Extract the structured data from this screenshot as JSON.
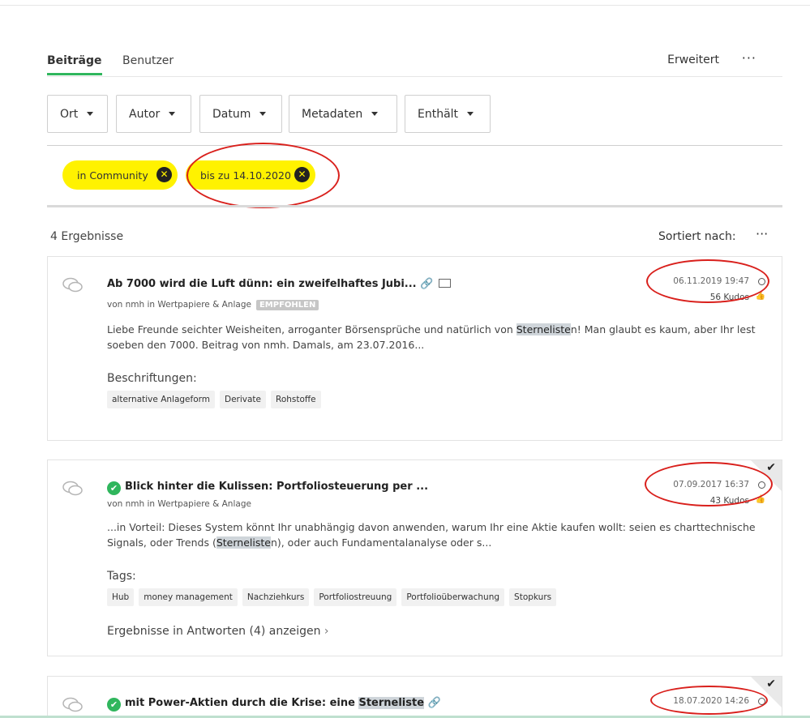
{
  "tabs": {
    "posts": "Beiträge",
    "users": "Benutzer",
    "advanced": "Erweitert",
    "more": "···"
  },
  "filters": [
    "Ort",
    "Autor",
    "Datum",
    "Metadaten",
    "Enthält"
  ],
  "chips": [
    "in Community",
    "bis zu 14.10.2020"
  ],
  "results": {
    "count": "4 Ergebnisse",
    "sort_label": "Sortiert nach:",
    "more": "···",
    "items": [
      {
        "title": "Ab 7000 wird die Luft dünn: ein zweifelhaftes Jubi...",
        "meta_by": "von nmh in Wertpapiere & Anlage",
        "badge": "EMPFOHLEN",
        "date": "06.11.2019 19:47",
        "kudos": "56 Kudos",
        "body_a": "Liebe Freunde seichter Weisheiten, arroganter Börsensprüche und natürlich von ",
        "body_hl": "Sterneliste",
        "body_b": "n!   Man glaubt es kaum, aber Ihr lest soeben den 7000. Beitrag von nmh.   Damals, am 23.07.2016...",
        "labels_heading": "Beschriftungen:",
        "labels": [
          "alternative Anlageform",
          "Derivate",
          "Rohstoffe"
        ]
      },
      {
        "title": "Blick hinter die Kulissen: Portfoliosteuerung per ...",
        "meta_by": "von nmh in Wertpapiere & Anlage",
        "date": "07.09.2017 16:37",
        "kudos": "43 Kudos",
        "body_a": "...in Vorteil: Dieses System könnt Ihr unabhängig davon anwenden, warum Ihr eine Aktie kaufen wollt: seien es charttechnische Signals, oder Trends (",
        "body_hl": "Sterneliste",
        "body_b": "n), oder auch Fundamentalanalyse oder s...",
        "labels_heading": "Tags:",
        "labels": [
          "Hub",
          "money management",
          "Nachziehkurs",
          "Portfoliostreuung",
          "Portfolioüberwachung",
          "Stopkurs"
        ],
        "replies": "Ergebnisse in Antworten (4) anzeigen"
      },
      {
        "title_a": "mit Power-Aktien durch die Krise: eine ",
        "title_hl": "Sterneliste",
        "date": "18.07.2020 14:26"
      }
    ]
  }
}
